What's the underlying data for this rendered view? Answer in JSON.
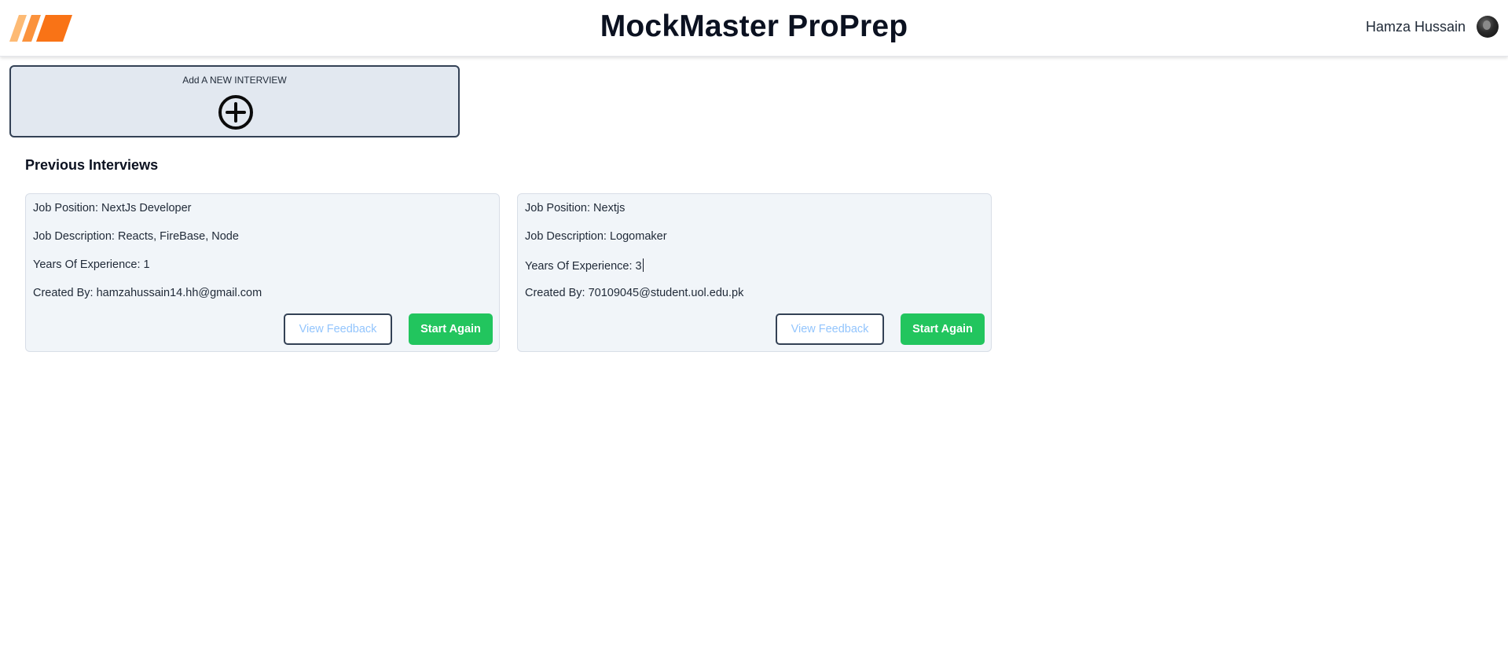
{
  "header": {
    "app_title": "MockMaster ProPrep",
    "user_name": "Hamza Hussain",
    "logo_icon": "stripes-logo-icon",
    "avatar_icon": "user-avatar-icon"
  },
  "add_interview": {
    "label": "Add A NEW INTERVIEW",
    "icon": "plus-circle-icon"
  },
  "previous": {
    "title": "Previous Interviews",
    "interviews": [
      {
        "job_position": "Job Position: NextJs Developer",
        "job_description": "Job Description: Reacts, FireBase, Node",
        "years_experience": "Years Of Experience: 1",
        "created_by": "Created By: hamzahussain14.hh@gmail.com",
        "feedback_label": "View Feedback",
        "start_label": "Start Again"
      },
      {
        "job_position": "Job Position: Nextjs",
        "job_description": "Job Description: Logomaker",
        "years_experience": "Years Of Experience: 3",
        "created_by": "Created By: 70109045@student.uol.edu.pk",
        "feedback_label": "View Feedback",
        "start_label": "Start Again"
      }
    ]
  },
  "colors": {
    "brand_orange": "#fb923c",
    "accent_green": "#22c55e",
    "feedback_text": "#93c5fd",
    "card_bg": "#f1f5f9",
    "add_card_bg": "#e2e8f0"
  }
}
